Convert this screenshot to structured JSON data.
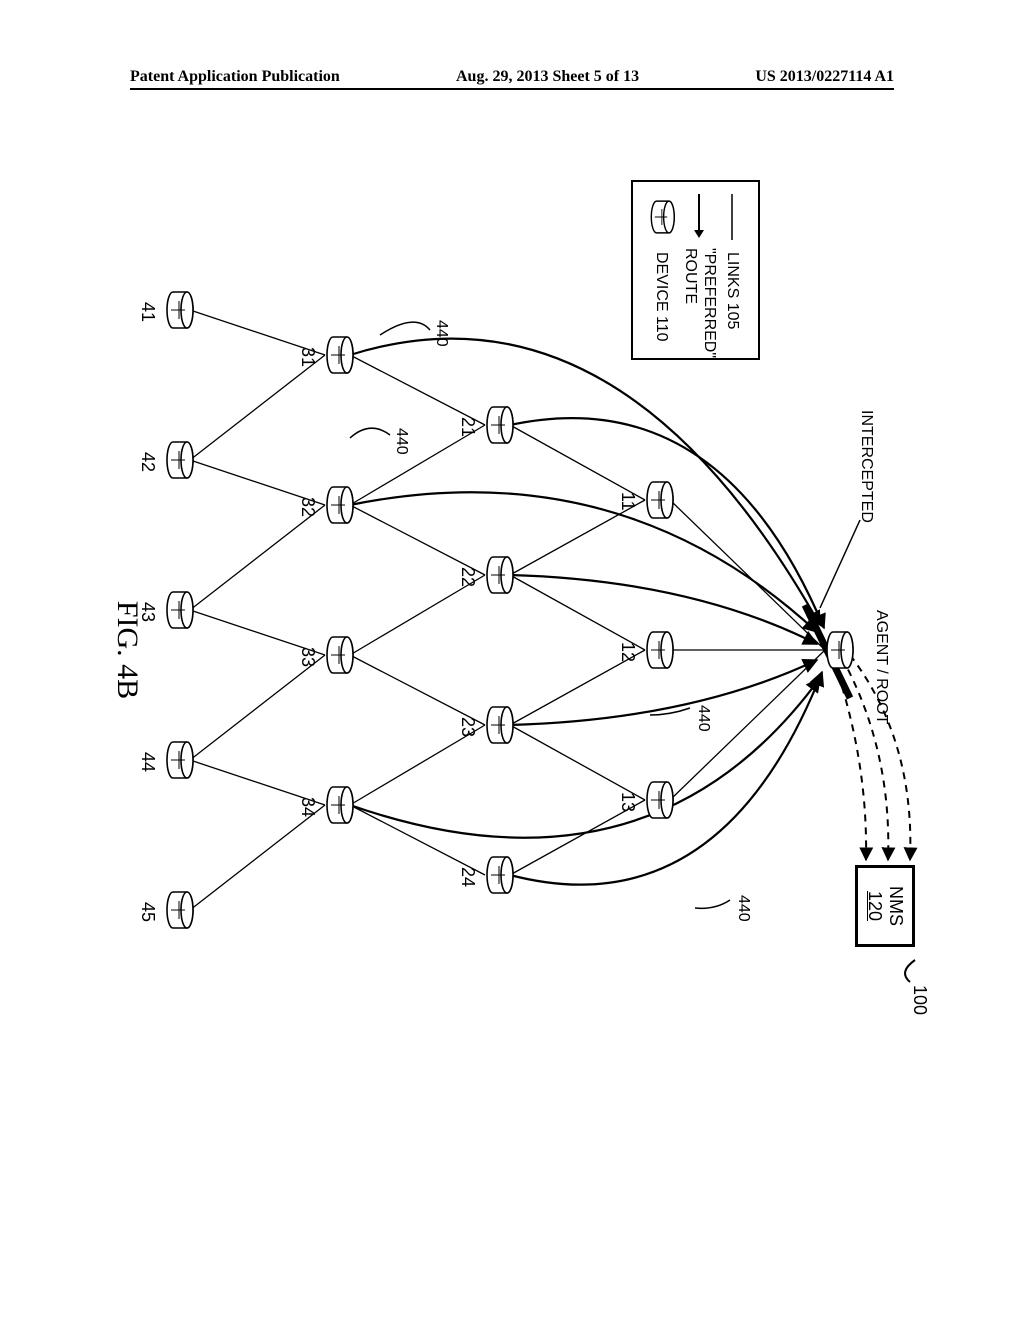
{
  "header": {
    "left": "Patent Application Publication",
    "center": "Aug. 29, 2013  Sheet 5 of 13",
    "right": "US 2013/0227114 A1"
  },
  "figure_label": "FIG. 4B",
  "diagram_ref": "100",
  "nms": {
    "title": "NMS",
    "num": "120"
  },
  "legend": {
    "links": "LINKS 105",
    "route": "\"PREFERRED\"\nROUTE",
    "device": "DEVICE 110"
  },
  "annot": {
    "agent_root": "AGENT / ROOT",
    "intercepted": "INTERCEPTED",
    "r440a": "440",
    "r440b": "440",
    "r440c": "440",
    "r440d": "440"
  },
  "nodes": {
    "n11": "11",
    "n12": "12",
    "n13": "13",
    "n21": "21",
    "n22": "22",
    "n23": "23",
    "n24": "24",
    "n31": "31",
    "n32": "32",
    "n33": "33",
    "n34": "34",
    "n41": "41",
    "n42": "42",
    "n43": "43",
    "n44": "44",
    "n45": "45"
  },
  "chart_data": {
    "type": "diagram",
    "description": "DAG-style mesh network with a root/agent node at top connected to NMS 120. Four rows of device nodes labeled 11-13, 21-24, 31-34, 41-45. Curved arrows labeled 440 show preferred routes from rows up toward the root where they are intercepted (thick bar) and forwarded via dashed arrows to NMS.",
    "root": "AGENT / ROOT",
    "nms": "NMS 120",
    "rows": [
      [
        "11",
        "12",
        "13"
      ],
      [
        "21",
        "22",
        "23",
        "24"
      ],
      [
        "31",
        "32",
        "33",
        "34"
      ],
      [
        "41",
        "42",
        "43",
        "44",
        "45"
      ]
    ],
    "links_105": [
      [
        "ROOT",
        "11"
      ],
      [
        "ROOT",
        "12"
      ],
      [
        "ROOT",
        "13"
      ],
      [
        "11",
        "21"
      ],
      [
        "11",
        "22"
      ],
      [
        "12",
        "22"
      ],
      [
        "12",
        "23"
      ],
      [
        "13",
        "23"
      ],
      [
        "13",
        "24"
      ],
      [
        "21",
        "31"
      ],
      [
        "21",
        "32"
      ],
      [
        "22",
        "32"
      ],
      [
        "22",
        "33"
      ],
      [
        "23",
        "33"
      ],
      [
        "23",
        "34"
      ],
      [
        "24",
        "34"
      ],
      [
        "31",
        "41"
      ],
      [
        "31",
        "42"
      ],
      [
        "32",
        "42"
      ],
      [
        "32",
        "43"
      ],
      [
        "33",
        "43"
      ],
      [
        "33",
        "44"
      ],
      [
        "34",
        "44"
      ],
      [
        "34",
        "45"
      ]
    ],
    "preferred_routes_440": [
      "from row 2/3/4 nodes curving up to ROOT, intercepted near ROOT, then dashed to NMS"
    ],
    "legend": {
      "solid_line": "LINKS 105",
      "arrow": "\"PREFERRED\" ROUTE",
      "cylinder": "DEVICE 110"
    },
    "reference_numeral": 100
  }
}
